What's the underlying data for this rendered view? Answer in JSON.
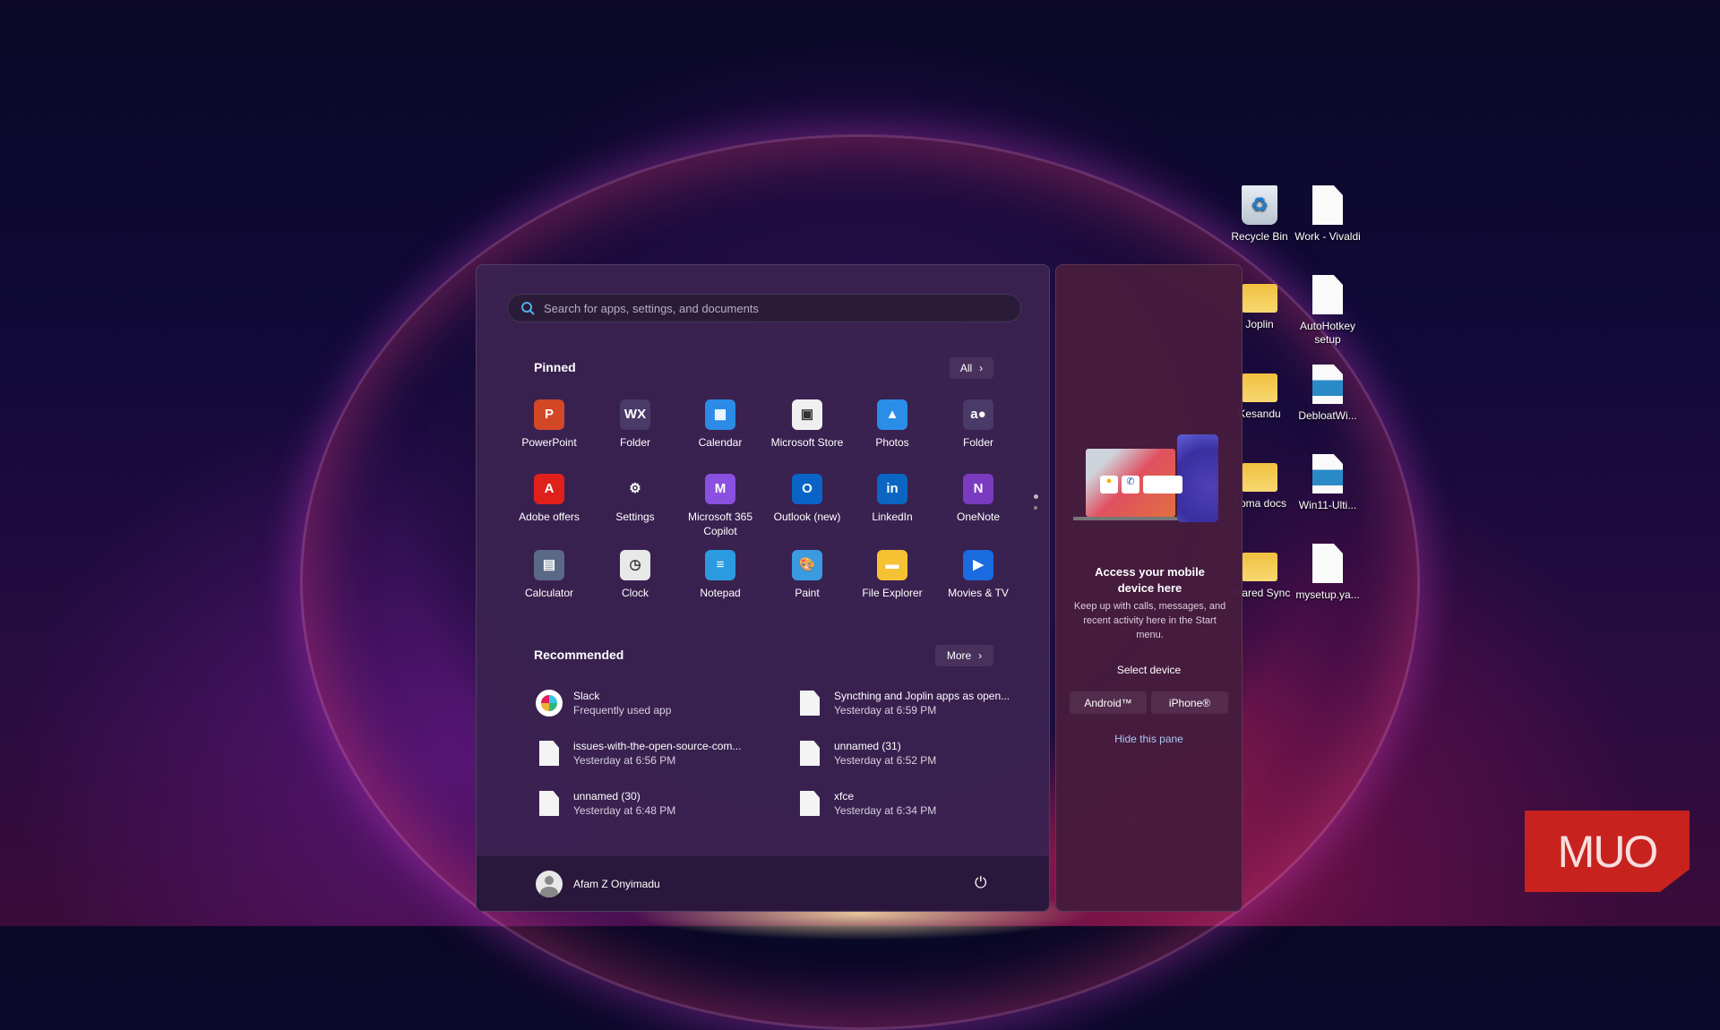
{
  "search": {
    "placeholder": "Search for apps, settings, and documents"
  },
  "pinned": {
    "title": "Pinned",
    "all_label": "All",
    "apps": [
      {
        "label": "PowerPoint",
        "icon": "powerpoint-icon",
        "color": "#d24726",
        "glyph": "P"
      },
      {
        "label": "Folder",
        "icon": "folder-word-excel-icon",
        "color": "#4a3a68",
        "glyph": "WX"
      },
      {
        "label": "Calendar",
        "icon": "calendar-icon",
        "color": "#2b8be6",
        "glyph": "▦"
      },
      {
        "label": "Microsoft Store",
        "icon": "store-icon",
        "color": "#f0f0f0",
        "glyph": "▣"
      },
      {
        "label": "Photos",
        "icon": "photos-icon",
        "color": "#2a8ee8",
        "glyph": "▲"
      },
      {
        "label": "Folder",
        "icon": "folder-amazon-spotify-icon",
        "color": "#4a3a68",
        "glyph": "a●"
      },
      {
        "label": "Adobe offers",
        "icon": "adobe-icon",
        "color": "#e0201b",
        "glyph": "A"
      },
      {
        "label": "Settings",
        "icon": "settings-gear-icon",
        "color": "transparent",
        "glyph": "⚙"
      },
      {
        "label": "Microsoft 365 Copilot",
        "icon": "m365-copilot-icon",
        "color": "#8a50e0",
        "glyph": "M"
      },
      {
        "label": "Outlook (new)",
        "icon": "outlook-icon",
        "color": "#0a64c8",
        "glyph": "O"
      },
      {
        "label": "LinkedIn",
        "icon": "linkedin-icon",
        "color": "#0a66c2",
        "glyph": "in"
      },
      {
        "label": "OneNote",
        "icon": "onenote-icon",
        "color": "#7a3bc0",
        "glyph": "N"
      },
      {
        "label": "Calculator",
        "icon": "calculator-icon",
        "color": "#5a6a86",
        "glyph": "▤"
      },
      {
        "label": "Clock",
        "icon": "clock-icon",
        "color": "#e8e8e8",
        "glyph": "◷"
      },
      {
        "label": "Notepad",
        "icon": "notepad-icon",
        "color": "#2a9be0",
        "glyph": "≡"
      },
      {
        "label": "Paint",
        "icon": "paint-icon",
        "color": "#3a9be0",
        "glyph": "🎨"
      },
      {
        "label": "File Explorer",
        "icon": "file-explorer-icon",
        "color": "#f5c234",
        "glyph": "▬"
      },
      {
        "label": "Movies & TV",
        "icon": "movies-tv-icon",
        "color": "#1a6ae0",
        "glyph": "▶"
      }
    ]
  },
  "recommended": {
    "title": "Recommended",
    "more_label": "More",
    "items": [
      {
        "name": "Slack",
        "sub": "Frequently used app",
        "icon": "slack-icon"
      },
      {
        "name": "Syncthing and Joplin apps as open...",
        "sub": "Yesterday at 6:59 PM",
        "icon": "file-icon"
      },
      {
        "name": "issues-with-the-open-source-com...",
        "sub": "Yesterday at 6:56 PM",
        "icon": "file-icon"
      },
      {
        "name": "unnamed (31)",
        "sub": "Yesterday at 6:52 PM",
        "icon": "file-icon"
      },
      {
        "name": "unnamed (30)",
        "sub": "Yesterday at 6:48 PM",
        "icon": "file-icon"
      },
      {
        "name": "xfce",
        "sub": "Yesterday at 6:34 PM",
        "icon": "file-icon"
      }
    ]
  },
  "user": {
    "name": "Afam Z Onyimadu"
  },
  "phone_pane": {
    "title": "Access your mobile device here",
    "description": "Keep up with calls, messages, and recent activity here in the Start menu.",
    "select_label": "Select device",
    "android": "Android™",
    "iphone": "iPhone®",
    "hide": "Hide this pane"
  },
  "desktop": [
    {
      "label": "Recycle Bin",
      "icon": "recycle-bin-icon"
    },
    {
      "label": "Work - Vivaldi",
      "icon": "shortcut-file-icon"
    },
    {
      "label": "Joplin",
      "icon": "folder-icon"
    },
    {
      "label": "AutoHotkey setup",
      "icon": "text-file-icon"
    },
    {
      "label": "Kesandu",
      "icon": "folder-icon"
    },
    {
      "label": "DebloatWi...",
      "icon": "powershell-file-icon"
    },
    {
      "label": "Soma docs",
      "icon": "folder-icon"
    },
    {
      "label": "Win11-Ulti...",
      "icon": "powershell-file-icon"
    },
    {
      "label": "Shared Sync",
      "icon": "folder-icon"
    },
    {
      "label": "mysetup.ya...",
      "icon": "file-icon"
    }
  ],
  "watermark": "MUO"
}
